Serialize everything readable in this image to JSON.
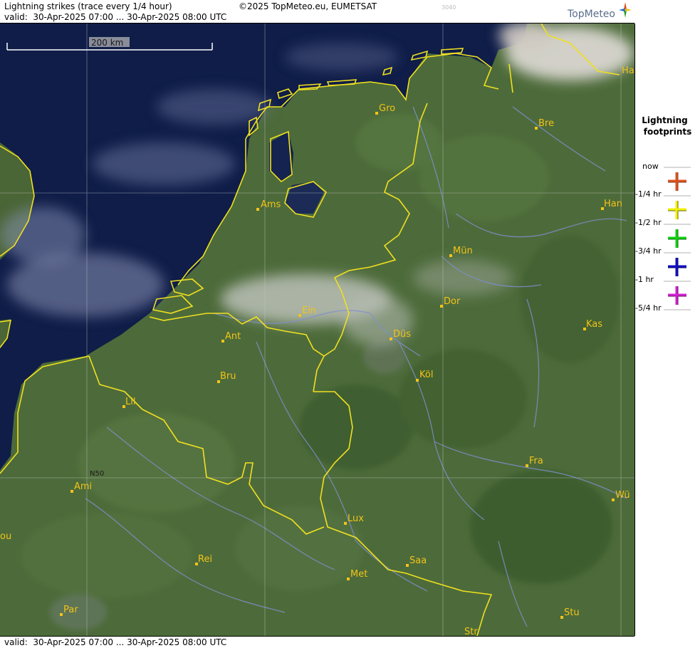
{
  "header": {
    "title": "Lightning strikes (trace every 1/4 hour)",
    "copyright": "©2025 TopMeteo.eu, EUMETSAT",
    "code": "3040",
    "valid": "valid:  30-Apr-2025 07:00 ... 30-Apr-2025 08:00 UTC",
    "logo": "TopMeteo"
  },
  "footer": {
    "valid": "valid:  30-Apr-2025 07:00 ... 30-Apr-2025 08:00 UTC"
  },
  "map": {
    "scale_label": "200 km",
    "latitude_label": "N50",
    "cities": [
      {
        "name": "Gro"
      },
      {
        "name": "Bre"
      },
      {
        "name": "Ams"
      },
      {
        "name": "Han"
      },
      {
        "name": "Mün"
      },
      {
        "name": "Dor"
      },
      {
        "name": "Ein"
      },
      {
        "name": "Ant"
      },
      {
        "name": "Düs"
      },
      {
        "name": "Kas"
      },
      {
        "name": "Bru"
      },
      {
        "name": "Köl"
      },
      {
        "name": "Lil"
      },
      {
        "name": "Fra"
      },
      {
        "name": "Ami"
      },
      {
        "name": "Wü"
      },
      {
        "name": "Lux"
      },
      {
        "name": "ou"
      },
      {
        "name": "Rei"
      },
      {
        "name": "Saa"
      },
      {
        "name": "Met"
      },
      {
        "name": "Par"
      },
      {
        "name": "Stu"
      },
      {
        "name": "Str"
      },
      {
        "name": "Ha"
      }
    ]
  },
  "legend": {
    "title_line1": "Lightning",
    "title_line2": "footprints",
    "entries": [
      {
        "label": "now",
        "color": "#e0501e"
      },
      {
        "label": "-1/4 hr",
        "color": "#f0f000"
      },
      {
        "label": "-1/2 hr",
        "color": "#10d010"
      },
      {
        "label": "-3/4 hr",
        "color": "#1010c0"
      },
      {
        "label": "-1 hr",
        "color": "#d020d0"
      },
      {
        "label": "-5/4 hr",
        "color": ""
      }
    ]
  },
  "colors": {
    "border": "#f0e020",
    "city": "#f2c318",
    "sea": "#0f1d48",
    "land": "#4d6b3a"
  }
}
